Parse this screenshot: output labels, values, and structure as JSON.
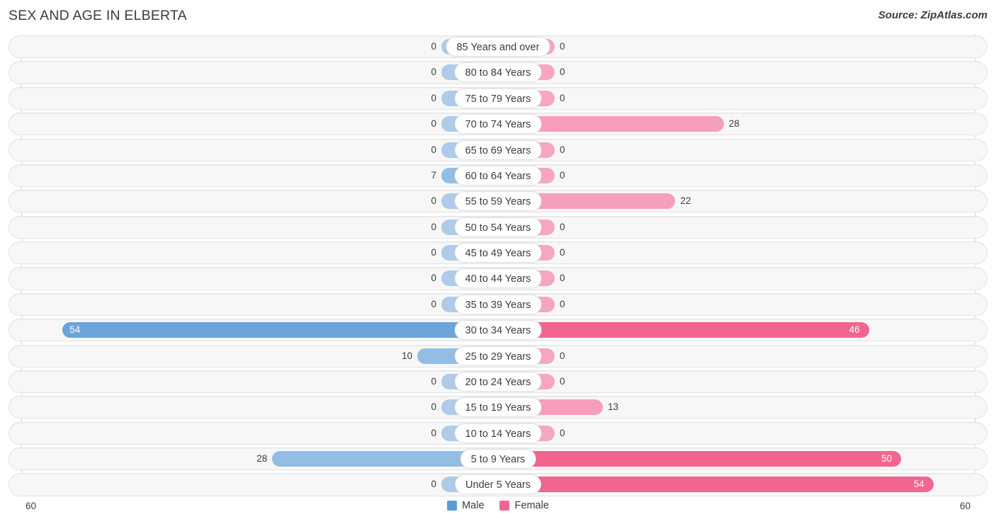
{
  "header": {
    "title": "SEX AND AGE IN ELBERTA",
    "source": "Source: ZipAtlas.com"
  },
  "legend": {
    "male_label": "Male",
    "female_label": "Female",
    "male_color": "#5b9bd5",
    "female_color": "#f2658f"
  },
  "axis": {
    "left_tick": "60",
    "right_tick": "60",
    "max": 60
  },
  "chart_data": {
    "type": "bar",
    "title": "SEX AND AGE IN ELBERTA",
    "subtitle": "Source: ZipAtlas.com",
    "orientation": "horizontal",
    "layout": "population-pyramid",
    "xlabel": "",
    "ylabel": "",
    "xlim": [
      60,
      60
    ],
    "grid": false,
    "legend_position": "bottom-center",
    "categories": [
      "85 Years and over",
      "80 to 84 Years",
      "75 to 79 Years",
      "70 to 74 Years",
      "65 to 69 Years",
      "60 to 64 Years",
      "55 to 59 Years",
      "50 to 54 Years",
      "45 to 49 Years",
      "40 to 44 Years",
      "35 to 39 Years",
      "30 to 34 Years",
      "25 to 29 Years",
      "20 to 24 Years",
      "15 to 19 Years",
      "10 to 14 Years",
      "5 to 9 Years",
      "Under 5 Years"
    ],
    "series": [
      {
        "name": "Male",
        "color": "#5b9bd5",
        "values": [
          0,
          0,
          0,
          0,
          0,
          7,
          0,
          0,
          0,
          0,
          0,
          54,
          10,
          0,
          0,
          0,
          28,
          0
        ]
      },
      {
        "name": "Female",
        "color": "#f2658f",
        "values": [
          0,
          0,
          0,
          28,
          0,
          0,
          22,
          0,
          0,
          0,
          0,
          46,
          0,
          0,
          13,
          0,
          50,
          54
        ]
      }
    ]
  },
  "rows": [
    {
      "label": "85 Years and over",
      "male": 0,
      "female": 0,
      "male_text": "0",
      "female_text": "0"
    },
    {
      "label": "80 to 84 Years",
      "male": 0,
      "female": 0,
      "male_text": "0",
      "female_text": "0"
    },
    {
      "label": "75 to 79 Years",
      "male": 0,
      "female": 0,
      "male_text": "0",
      "female_text": "0"
    },
    {
      "label": "70 to 74 Years",
      "male": 0,
      "female": 28,
      "male_text": "0",
      "female_text": "28"
    },
    {
      "label": "65 to 69 Years",
      "male": 0,
      "female": 0,
      "male_text": "0",
      "female_text": "0"
    },
    {
      "label": "60 to 64 Years",
      "male": 7,
      "female": 0,
      "male_text": "7",
      "female_text": "0"
    },
    {
      "label": "55 to 59 Years",
      "male": 0,
      "female": 22,
      "male_text": "0",
      "female_text": "22"
    },
    {
      "label": "50 to 54 Years",
      "male": 0,
      "female": 0,
      "male_text": "0",
      "female_text": "0"
    },
    {
      "label": "45 to 49 Years",
      "male": 0,
      "female": 0,
      "male_text": "0",
      "female_text": "0"
    },
    {
      "label": "40 to 44 Years",
      "male": 0,
      "female": 0,
      "male_text": "0",
      "female_text": "0"
    },
    {
      "label": "35 to 39 Years",
      "male": 0,
      "female": 0,
      "male_text": "0",
      "female_text": "0"
    },
    {
      "label": "30 to 34 Years",
      "male": 54,
      "female": 46,
      "male_text": "54",
      "female_text": "46"
    },
    {
      "label": "25 to 29 Years",
      "male": 10,
      "female": 0,
      "male_text": "10",
      "female_text": "0"
    },
    {
      "label": "20 to 24 Years",
      "male": 0,
      "female": 0,
      "male_text": "0",
      "female_text": "0"
    },
    {
      "label": "15 to 19 Years",
      "male": 0,
      "female": 13,
      "male_text": "0",
      "female_text": "13"
    },
    {
      "label": "10 to 14 Years",
      "male": 0,
      "female": 0,
      "male_text": "0",
      "female_text": "0"
    },
    {
      "label": "5 to 9 Years",
      "male": 28,
      "female": 50,
      "male_text": "28",
      "female_text": "50"
    },
    {
      "label": "Under 5 Years",
      "male": 0,
      "female": 54,
      "male_text": "0",
      "female_text": "54"
    }
  ]
}
